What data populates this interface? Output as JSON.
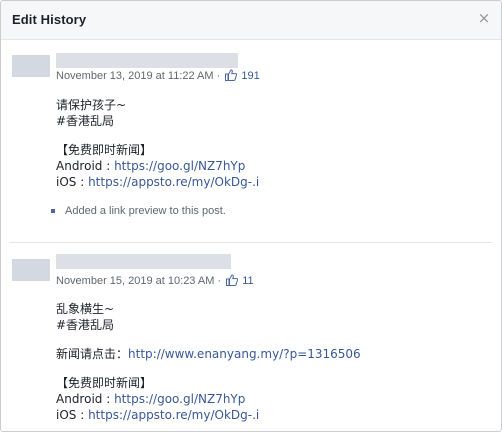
{
  "dialog": {
    "title": "Edit History",
    "close_glyph": "×"
  },
  "posts": [
    {
      "timestamp": "November 13, 2019 at 11:22 AM",
      "separator": "·",
      "likes": "191",
      "lines": [
        "请保护孩子~",
        "#香港乱局",
        "",
        "【免费即时新闻】"
      ],
      "android_label": "Android : ",
      "android_link": "https://goo.gl/NZ7hYp",
      "ios_label": "iOS : ",
      "ios_link": "https://appsto.re/my/OkDg-.i",
      "note": "Added a link preview to this post."
    },
    {
      "timestamp": "November 15, 2019 at 10:23 AM",
      "separator": "·",
      "likes": "11",
      "lines": [
        "乱象横生~",
        "#香港乱局"
      ],
      "news_label": "新闻请点击：",
      "news_link": "http://www.enanyang.my/?p=1316506",
      "promo": "【免费即时新闻】",
      "android_label": "Android : ",
      "android_link": "https://goo.gl/NZ7hYp",
      "ios_label": "iOS : ",
      "ios_link": "https://appsto.re/my/OkDg-.i"
    }
  ],
  "colors": {
    "link": "#385898",
    "header_bg": "#f6f7f9",
    "redaction": "#dcdfe6"
  },
  "icons": [
    "close-icon",
    "like-icon",
    "bullet-icon"
  ]
}
